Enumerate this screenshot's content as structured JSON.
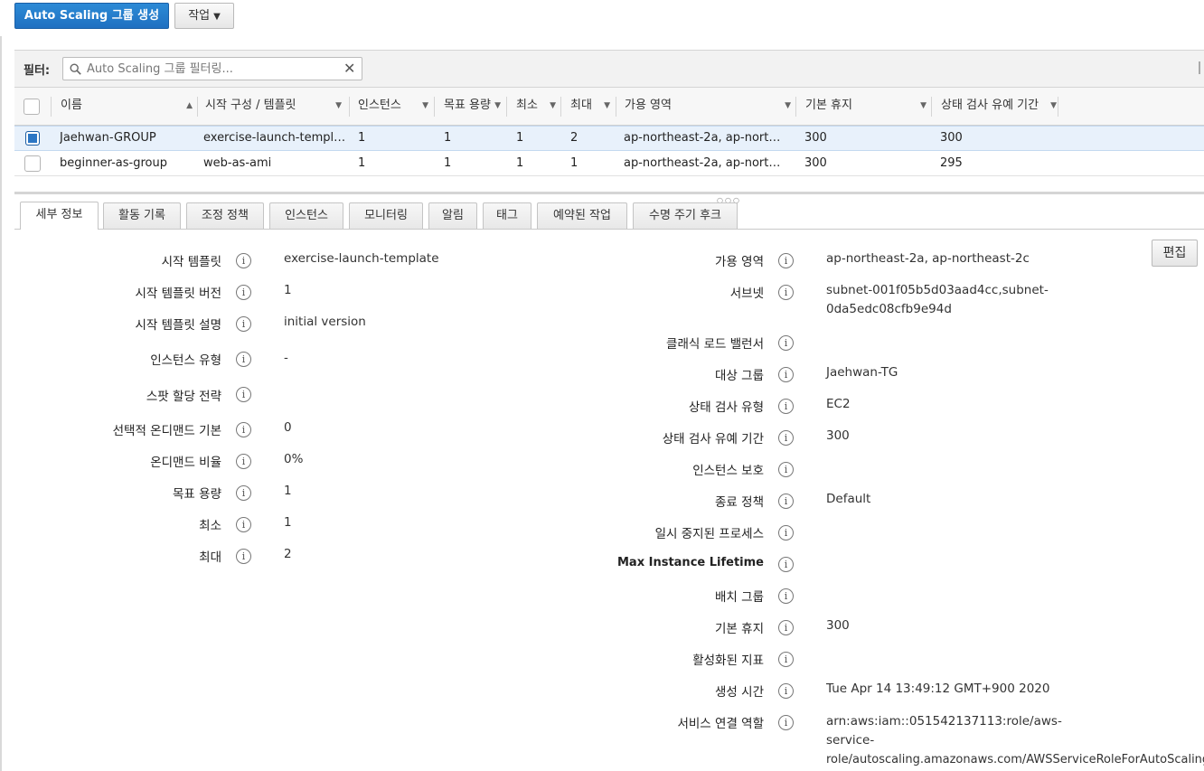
{
  "toolbar": {
    "create_label": "Auto Scaling 그룹 생성",
    "actions_label": "작업"
  },
  "filter": {
    "label": "필터:",
    "placeholder": "Auto Scaling 그룹 필터링..."
  },
  "table": {
    "columns": [
      "이름",
      "시작 구성 / 템플릿",
      "인스턴스",
      "목표 용량",
      "최소",
      "최대",
      "가용 영역",
      "기본 휴지",
      "상태 검사 유예 기간"
    ],
    "rows": [
      {
        "selected": true,
        "name": "Jaehwan-GROUP",
        "template": "exercise-launch-template",
        "instances": "1",
        "desired": "1",
        "min": "1",
        "max": "2",
        "az": "ap-northeast-2a, ap-northeast-2c",
        "cooldown": "300",
        "grace": "300"
      },
      {
        "selected": false,
        "name": "beginner-as-group",
        "template": "web-as-ami",
        "instances": "1",
        "desired": "1",
        "min": "1",
        "max": "1",
        "az": "ap-northeast-2a, ap-northeast-2c",
        "cooldown": "300",
        "grace": "295"
      }
    ]
  },
  "tabs": [
    "세부 정보",
    "활동 기록",
    "조정 정책",
    "인스턴스",
    "모니터링",
    "알림",
    "태그",
    "예약된 작업",
    "수명 주기 후크"
  ],
  "active_tab": "세부 정보",
  "details": {
    "edit_label": "편집",
    "left": [
      {
        "label": "시작 템플릿",
        "value": "exercise-launch-template"
      },
      {
        "label": "시작 템플릿 버전",
        "value": "1"
      },
      {
        "label": "시작 템플릿 설명",
        "value": "initial version"
      },
      {
        "label": "인스턴스 유형",
        "value": "-"
      },
      {
        "label": "스팟 할당 전략",
        "value": ""
      },
      {
        "label": "선택적 온디맨드 기본",
        "value": "0"
      },
      {
        "label": "온디맨드 비율",
        "value": "0%"
      },
      {
        "label": "목표 용량",
        "value": "1"
      },
      {
        "label": "최소",
        "value": "1"
      },
      {
        "label": "최대",
        "value": "2"
      }
    ],
    "right": [
      {
        "label": "가용 영역",
        "value": "ap-northeast-2a, ap-northeast-2c"
      },
      {
        "label": "서브넷",
        "value": [
          "subnet-001f05b5d03aad4cc,subnet-",
          "0da5edc08cfb9e94d"
        ]
      },
      {
        "label": "클래식 로드 밸런서",
        "value": ""
      },
      {
        "label": "대상 그룹",
        "value": "Jaehwan-TG"
      },
      {
        "label": "상태 검사 유형",
        "value": "EC2"
      },
      {
        "label": "상태 검사 유예 기간",
        "value": "300"
      },
      {
        "label": "인스턴스 보호",
        "value": ""
      },
      {
        "label": "종료 정책",
        "value": "Default"
      },
      {
        "label": "일시 중지된 프로세스",
        "value": ""
      },
      {
        "label": "Max Instance Lifetime",
        "value": ""
      },
      {
        "label": "배치 그룹",
        "value": ""
      },
      {
        "label": "기본 휴지",
        "value": "300"
      },
      {
        "label": "활성화된 지표",
        "value": ""
      },
      {
        "label": "생성 시간",
        "value": "Tue Apr 14 13:49:12 GMT+900 2020"
      },
      {
        "label": "서비스 연결 역할",
        "value": [
          "arn:aws:iam::051542137113:role/aws-",
          "service-",
          "role/autoscaling.amazonaws.com/AWSServiceRoleForAutoScaling"
        ]
      }
    ]
  },
  "colors": {
    "primary": "#1f70c1",
    "selected_row": "#e8f1fb",
    "checked": "#2b76c4"
  }
}
